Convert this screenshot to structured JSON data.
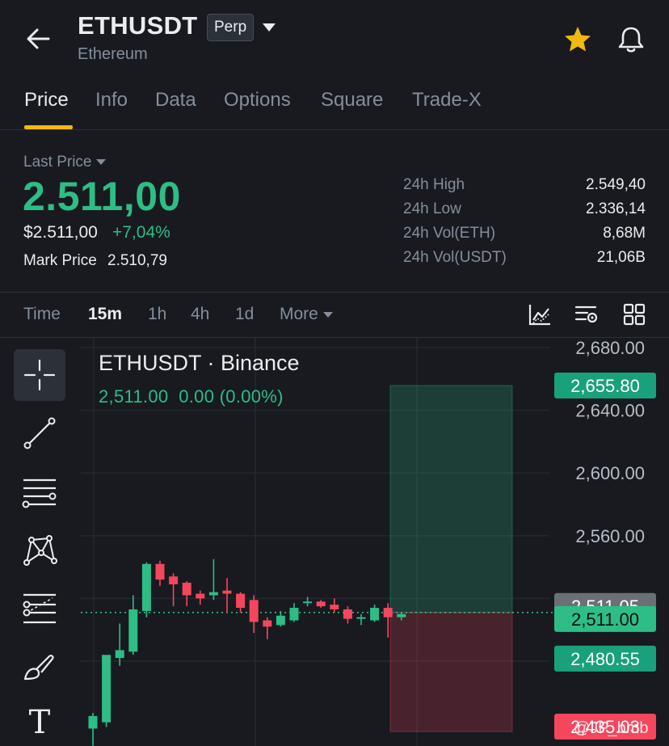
{
  "header": {
    "symbol": "ETHUSDT",
    "badge": "Perp",
    "subtitle": "Ethereum"
  },
  "tabs": [
    {
      "label": "Price",
      "active": true
    },
    {
      "label": "Info"
    },
    {
      "label": "Data"
    },
    {
      "label": "Options"
    },
    {
      "label": "Square"
    },
    {
      "label": "Trade-X"
    }
  ],
  "price": {
    "last_label": "Last Price",
    "last_value": "2.511,00",
    "usd_value": "$2.511,00",
    "change_pct": "+7,04%",
    "mark_label": "Mark Price",
    "mark_value": "2.510,79"
  },
  "stats": [
    {
      "label": "24h High",
      "value": "2.549,40"
    },
    {
      "label": "24h Low",
      "value": "2.336,14"
    },
    {
      "label": "24h Vol(ETH)",
      "value": "8,68M"
    },
    {
      "label": "24h Vol(USDT)",
      "value": "21,06B"
    }
  ],
  "timeframes": [
    {
      "label": "Time"
    },
    {
      "label": "15m",
      "active": true
    },
    {
      "label": "1h"
    },
    {
      "label": "4h"
    },
    {
      "label": "1d"
    },
    {
      "label": "More",
      "dropdown": true
    }
  ],
  "colors": {
    "up": "#2ebd85",
    "down": "#f6465d",
    "accent": "#f0b90b",
    "background": "#181a20"
  },
  "icons": {
    "back": "back-arrow-icon",
    "caret": "caret-down-icon",
    "star": "star-icon",
    "bell": "bell-icon",
    "indicators": "indicator-icon",
    "settings": "chart-settings-icon",
    "layout": "grid-layout-icon"
  },
  "tools": [
    {
      "name": "crosshair-tool",
      "active": true
    },
    {
      "name": "trend-line-tool"
    },
    {
      "name": "horizontal-lines-tool"
    },
    {
      "name": "pattern-tool"
    },
    {
      "name": "fibonacci-tool"
    },
    {
      "name": "brush-tool"
    },
    {
      "name": "text-tool",
      "glyph": "T"
    }
  ],
  "chart": {
    "title": "ETHUSDT · Binance",
    "ohlc_price": "2,511.00",
    "ohlc_change": "0.00 (0.00%)",
    "price_labels": [
      {
        "text": "2,655.80",
        "value": 2655.8,
        "kind": "target"
      },
      {
        "text": "2,511.05",
        "value": 2511.05,
        "kind": "mark"
      },
      {
        "text": "2,511.00",
        "value": 2511.0,
        "kind": "last"
      },
      {
        "text": "2,480.55",
        "value": 2480.55,
        "kind": "stop"
      },
      {
        "text": "2,435.03",
        "value": 2435.03,
        "kind": "low"
      }
    ]
  },
  "watermark": "@JF_bmb",
  "chart_data": {
    "type": "candlestick",
    "interval": "15m",
    "y_ticks": [
      2680,
      2640,
      2600,
      2560
    ],
    "ylim": [
      2432,
      2692
    ],
    "current_price": 2511.0,
    "position": {
      "entry": 2511.0,
      "target": 2655.8,
      "stop": 2435.03
    },
    "candles": [
      {
        "o": 2437,
        "h": 2447,
        "l": 2426,
        "c": 2445
      },
      {
        "o": 2441,
        "h": 2473,
        "l": 2438,
        "c": 2484
      },
      {
        "o": 2482,
        "h": 2504,
        "l": 2477,
        "c": 2487
      },
      {
        "o": 2486,
        "h": 2522,
        "l": 2484,
        "c": 2513
      },
      {
        "o": 2512,
        "h": 2543,
        "l": 2508,
        "c": 2542
      },
      {
        "o": 2542,
        "h": 2544,
        "l": 2528,
        "c": 2532
      },
      {
        "o": 2534,
        "h": 2536,
        "l": 2515,
        "c": 2529
      },
      {
        "o": 2530,
        "h": 2531,
        "l": 2515,
        "c": 2522
      },
      {
        "o": 2523,
        "h": 2525,
        "l": 2516,
        "c": 2520
      },
      {
        "o": 2522,
        "h": 2545,
        "l": 2519,
        "c": 2524
      },
      {
        "o": 2525,
        "h": 2533,
        "l": 2511,
        "c": 2523
      },
      {
        "o": 2523,
        "h": 2524,
        "l": 2511,
        "c": 2514
      },
      {
        "o": 2519,
        "h": 2522,
        "l": 2498,
        "c": 2505
      },
      {
        "o": 2506,
        "h": 2508,
        "l": 2494,
        "c": 2502
      },
      {
        "o": 2503,
        "h": 2512,
        "l": 2502,
        "c": 2509
      },
      {
        "o": 2506,
        "h": 2517,
        "l": 2505,
        "c": 2514
      },
      {
        "o": 2517,
        "h": 2521,
        "l": 2515,
        "c": 2518
      },
      {
        "o": 2518,
        "h": 2519,
        "l": 2514,
        "c": 2515
      },
      {
        "o": 2516,
        "h": 2520,
        "l": 2511,
        "c": 2513
      },
      {
        "o": 2513,
        "h": 2515,
        "l": 2504,
        "c": 2507
      },
      {
        "o": 2507,
        "h": 2510,
        "l": 2503,
        "c": 2508
      },
      {
        "o": 2506,
        "h": 2516,
        "l": 2505,
        "c": 2514
      },
      {
        "o": 2514,
        "h": 2517,
        "l": 2495,
        "c": 2508
      },
      {
        "o": 2508,
        "h": 2511,
        "l": 2506,
        "c": 2510
      }
    ]
  }
}
